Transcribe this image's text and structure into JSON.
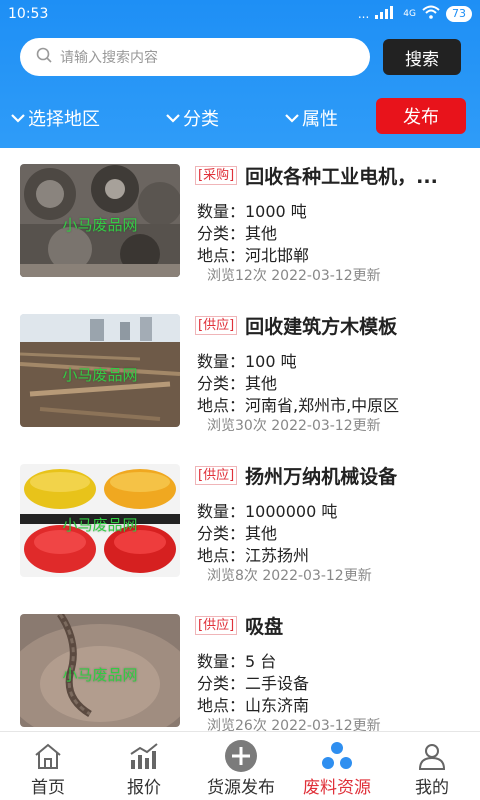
{
  "status": {
    "time": "10:53",
    "dots": "...",
    "network": "4G",
    "battery": "73"
  },
  "search": {
    "placeholder": "请输入搜索内容",
    "button": "搜索"
  },
  "filters": {
    "region": "选择地区",
    "category": "分类",
    "attribute": "属性",
    "publish": "发布"
  },
  "items": [
    {
      "tag": "[采购]",
      "title": "回收各种工业电机，...",
      "quantity": "数量：1000 吨",
      "category": "分类：其他",
      "location": "地点：河北邯郸",
      "meta": "浏览12次 2022-03-12更新",
      "watermark": "小马废品网"
    },
    {
      "tag": "[供应]",
      "title": "回收建筑方木模板",
      "quantity": "数量：100 吨",
      "category": "分类：其他",
      "location": "地点：河南省,郑州市,中原区",
      "meta": "浏览30次 2022-03-12更新",
      "watermark": "小马废品网"
    },
    {
      "tag": "[供应]",
      "title": "扬州万纳机械设备",
      "quantity": "数量：1000000 吨",
      "category": "分类：其他",
      "location": "地点：江苏扬州",
      "meta": "浏览8次 2022-03-12更新",
      "watermark": "小马废品网"
    },
    {
      "tag": "[供应]",
      "title": "吸盘",
      "quantity": "数量：5 台",
      "category": "分类：二手设备",
      "location": "地点：山东济南",
      "meta": "浏览26次 2022-03-12更新",
      "watermark": "小马废品网"
    }
  ],
  "tabs": [
    {
      "label": "首页",
      "icon": "home-icon"
    },
    {
      "label": "报价",
      "icon": "chart-icon"
    },
    {
      "label": "货源发布",
      "icon": "plus-circle-icon"
    },
    {
      "label": "废料资源",
      "icon": "nodes-icon",
      "active": true
    },
    {
      "label": "我的",
      "icon": "user-icon"
    }
  ],
  "colors": {
    "header": "#1e8ff5",
    "publish": "#e8131b",
    "accent": "#e0313a"
  }
}
